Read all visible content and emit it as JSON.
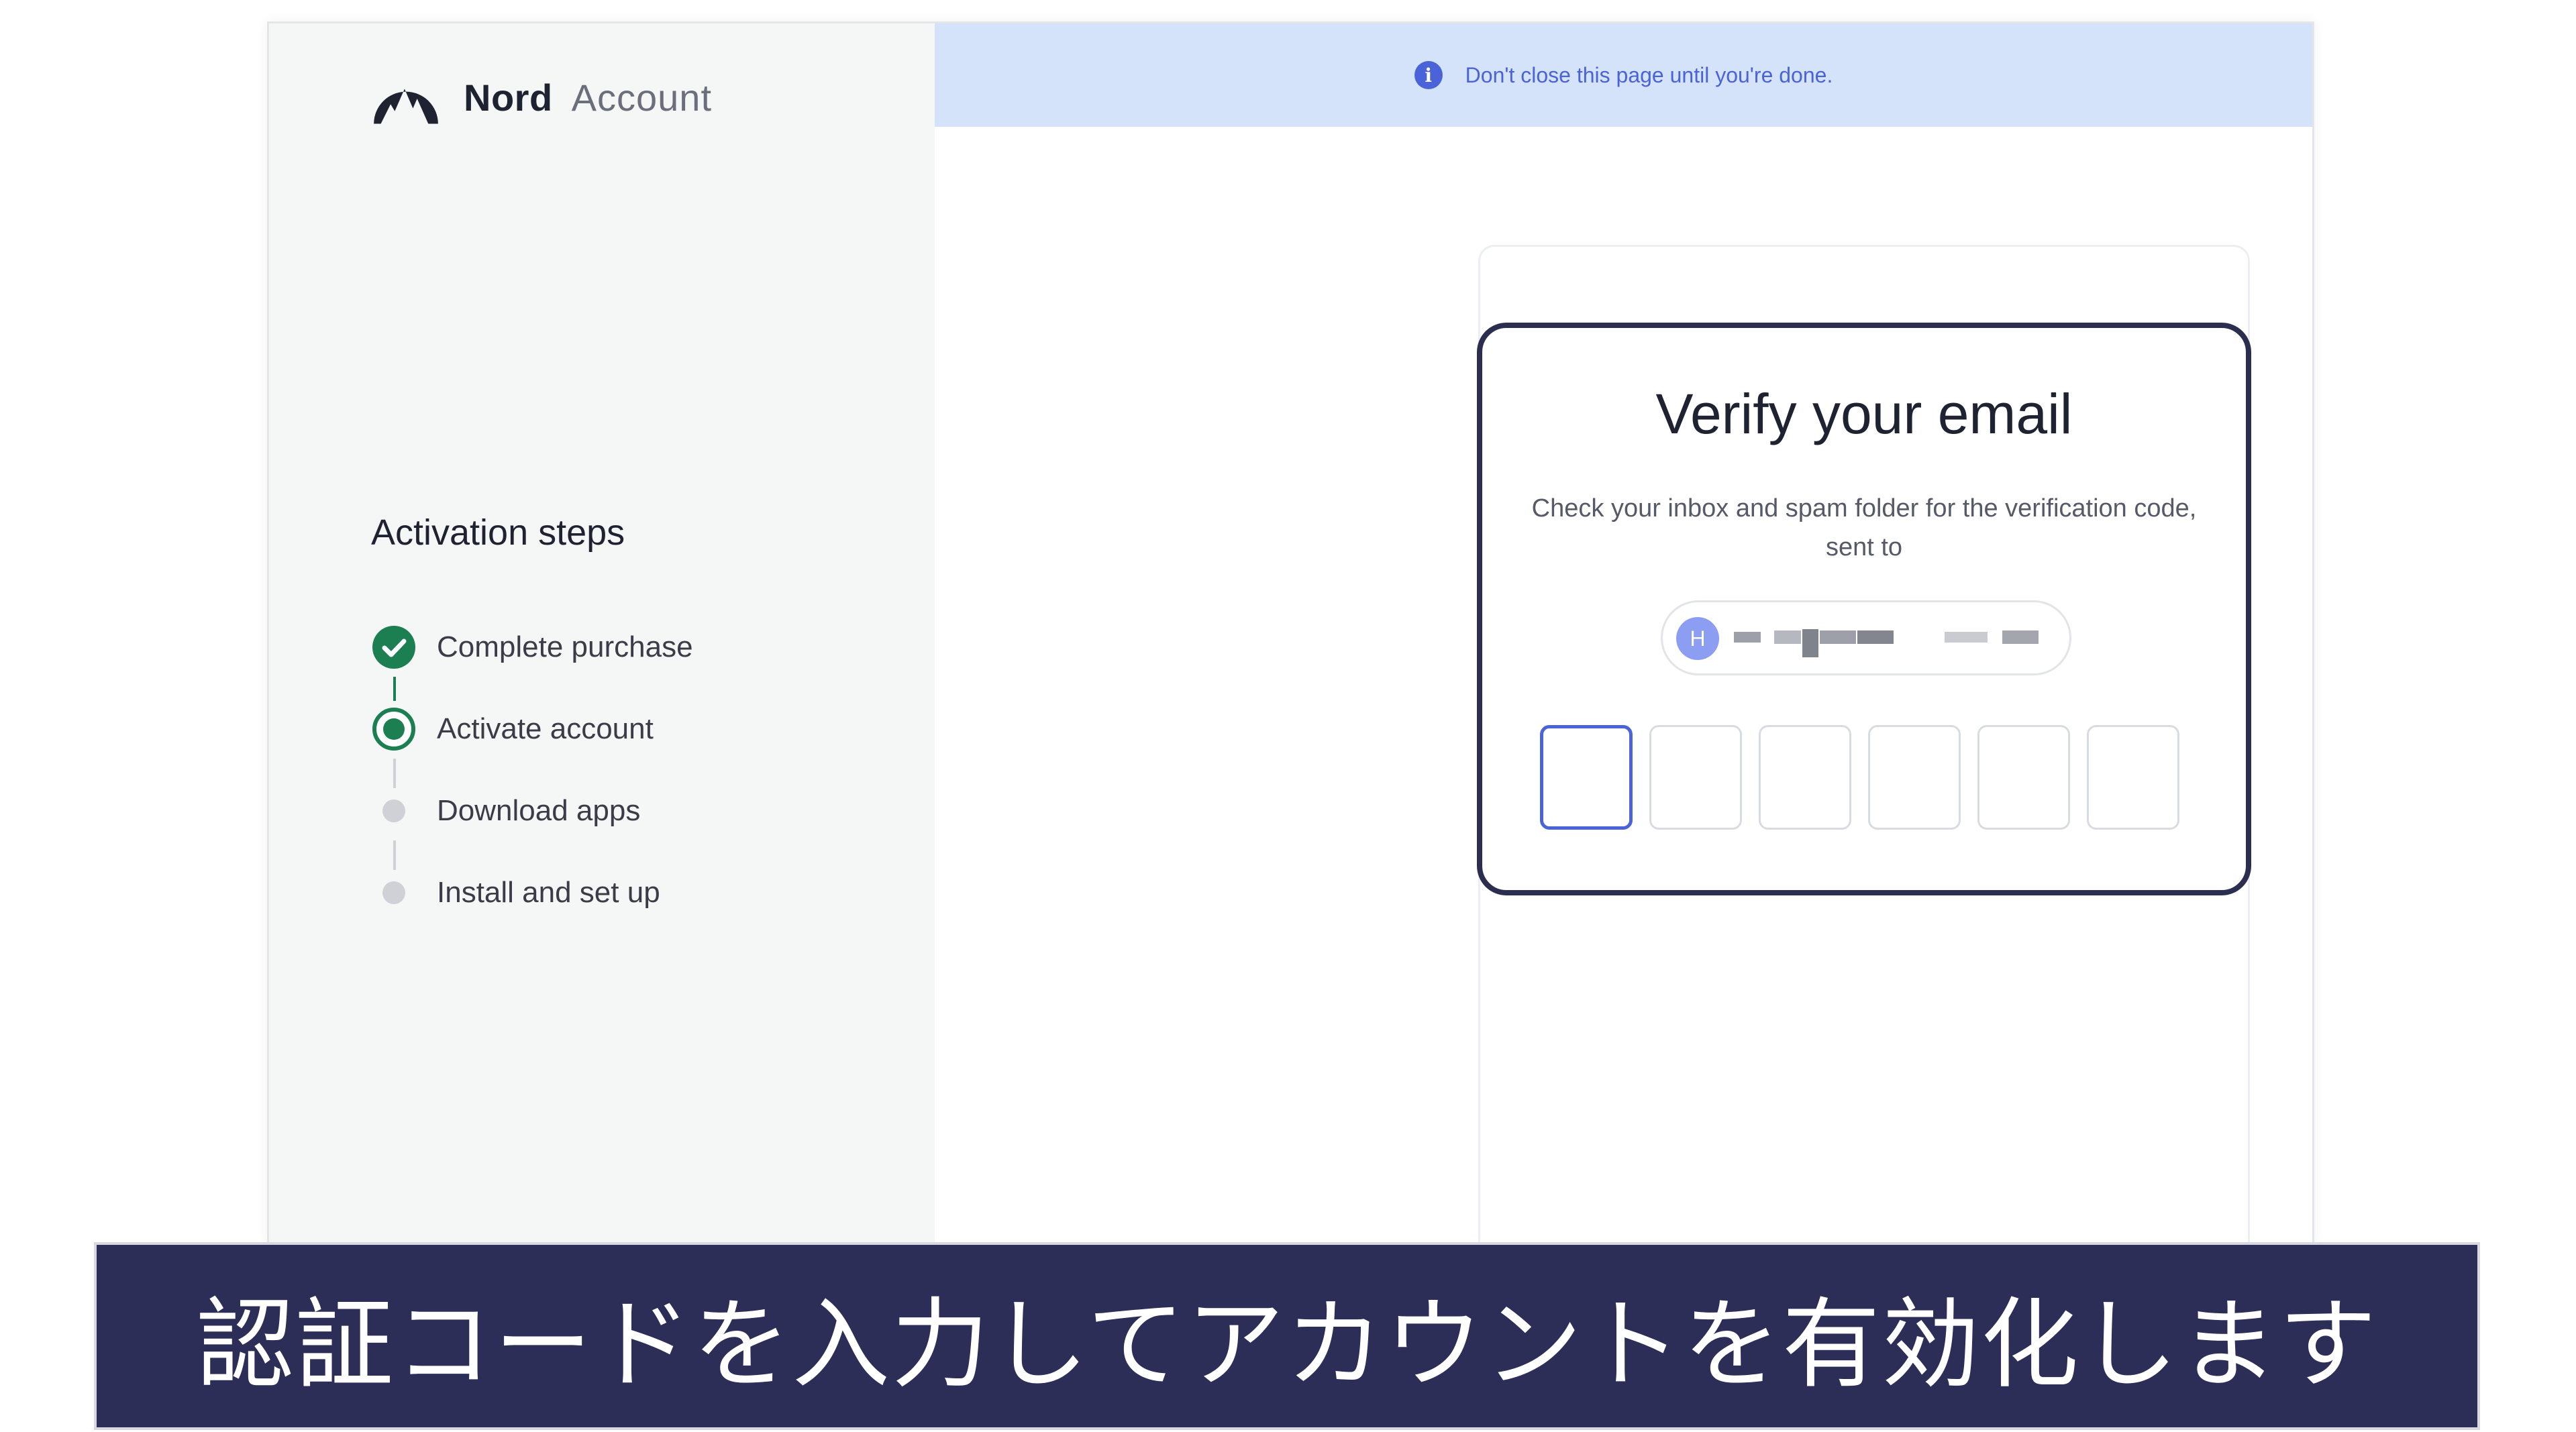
{
  "brand": {
    "name": "Nord",
    "product": "Account",
    "logo_icon": "nord-mountain-icon"
  },
  "banner": {
    "text": "Don't close this page until you're done.",
    "icon": "info-icon",
    "color": "#4a63d8"
  },
  "sidebar": {
    "title": "Activation steps",
    "steps": [
      {
        "label": "Complete purchase",
        "state": "done"
      },
      {
        "label": "Activate account",
        "state": "current"
      },
      {
        "label": "Download apps",
        "state": "pending"
      },
      {
        "label": "Install and set up",
        "state": "pending"
      }
    ]
  },
  "verify": {
    "title": "Verify your email",
    "description": "Check your inbox and spam folder for the verification code, sent to",
    "email_avatar_initial": "H",
    "email_value": "",
    "code_digits": [
      "",
      "",
      "",
      "",
      "",
      ""
    ]
  },
  "caption": {
    "text": "認証コードを入力してアカウントを有効化します"
  },
  "colors": {
    "accent": "#4a63d8",
    "success": "#1c7f52",
    "caption_bg": "#2c2e58",
    "banner_bg": "#d5e3fa"
  }
}
